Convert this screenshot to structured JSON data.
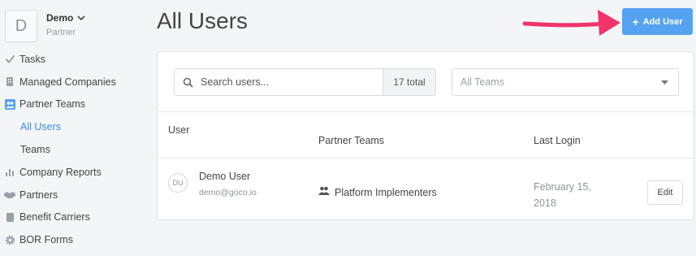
{
  "account": {
    "initial": "D",
    "name": "Demo",
    "role": "Partner"
  },
  "nav": {
    "tasks": "Tasks",
    "managed_companies": "Managed Companies",
    "partner_teams": "Partner Teams",
    "all_users": "All Users",
    "teams": "Teams",
    "company_reports": "Company Reports",
    "partners": "Partners",
    "benefit_carriers": "Benefit Carriers",
    "bor_forms": "BOR Forms"
  },
  "page": {
    "title": "All Users",
    "add_button": "Add User"
  },
  "search": {
    "placeholder": "Search users...",
    "total": "17 total"
  },
  "teams_filter": {
    "selected": "All Teams"
  },
  "table": {
    "headers": {
      "user": "User",
      "teams": "Partner Teams",
      "last_login": "Last Login"
    },
    "rows": [
      {
        "initials": "DU",
        "name": "Demo User",
        "email": "demo@goco.io",
        "team": "Platform Implementers",
        "last_login": "February 15, 2018",
        "action": "Edit"
      }
    ]
  },
  "colors": {
    "accent": "#54a3f0",
    "active_nav": "#3c8de0",
    "arrow": "#f0336b"
  },
  "icons": {
    "tasks": "check-icon",
    "companies": "building-icon",
    "partner_teams": "team-icon",
    "reports": "bar-chart-icon",
    "partners": "handshake-icon",
    "carriers": "document-icon",
    "bor": "gear-icon",
    "search": "search-icon",
    "team_row": "users-icon"
  }
}
